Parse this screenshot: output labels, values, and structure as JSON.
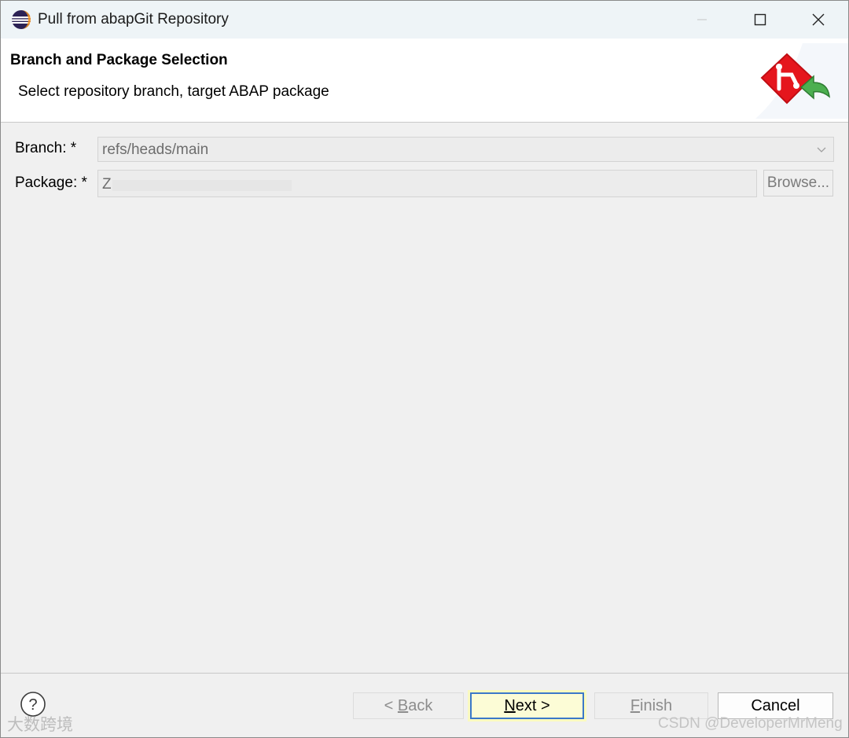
{
  "window": {
    "title": "Pull from abapGit Repository"
  },
  "banner": {
    "title": "Branch and Package Selection",
    "description": "Select repository branch, target ABAP package"
  },
  "form": {
    "branch_label": "Branch: *",
    "branch_value": "refs/heads/main",
    "package_label": "Package: *",
    "package_value": "Z",
    "browse_label": "Browse..."
  },
  "buttons": {
    "back_prefix": "< ",
    "back_mnemonic": "B",
    "back_rest": "ack",
    "next_mnemonic": "N",
    "next_rest": "ext >",
    "finish_mnemonic": "F",
    "finish_rest": "inish",
    "cancel": "Cancel"
  },
  "watermarks": {
    "left": "大数跨境",
    "right": "CSDN @DeveloperMrMeng"
  },
  "colors": {
    "title_bar": "#eef4f7",
    "banner": "#ffffff",
    "dialog": "#f0f0f0",
    "default_button_border": "#3b78c9",
    "default_button_fill": "#fcfcd6"
  }
}
